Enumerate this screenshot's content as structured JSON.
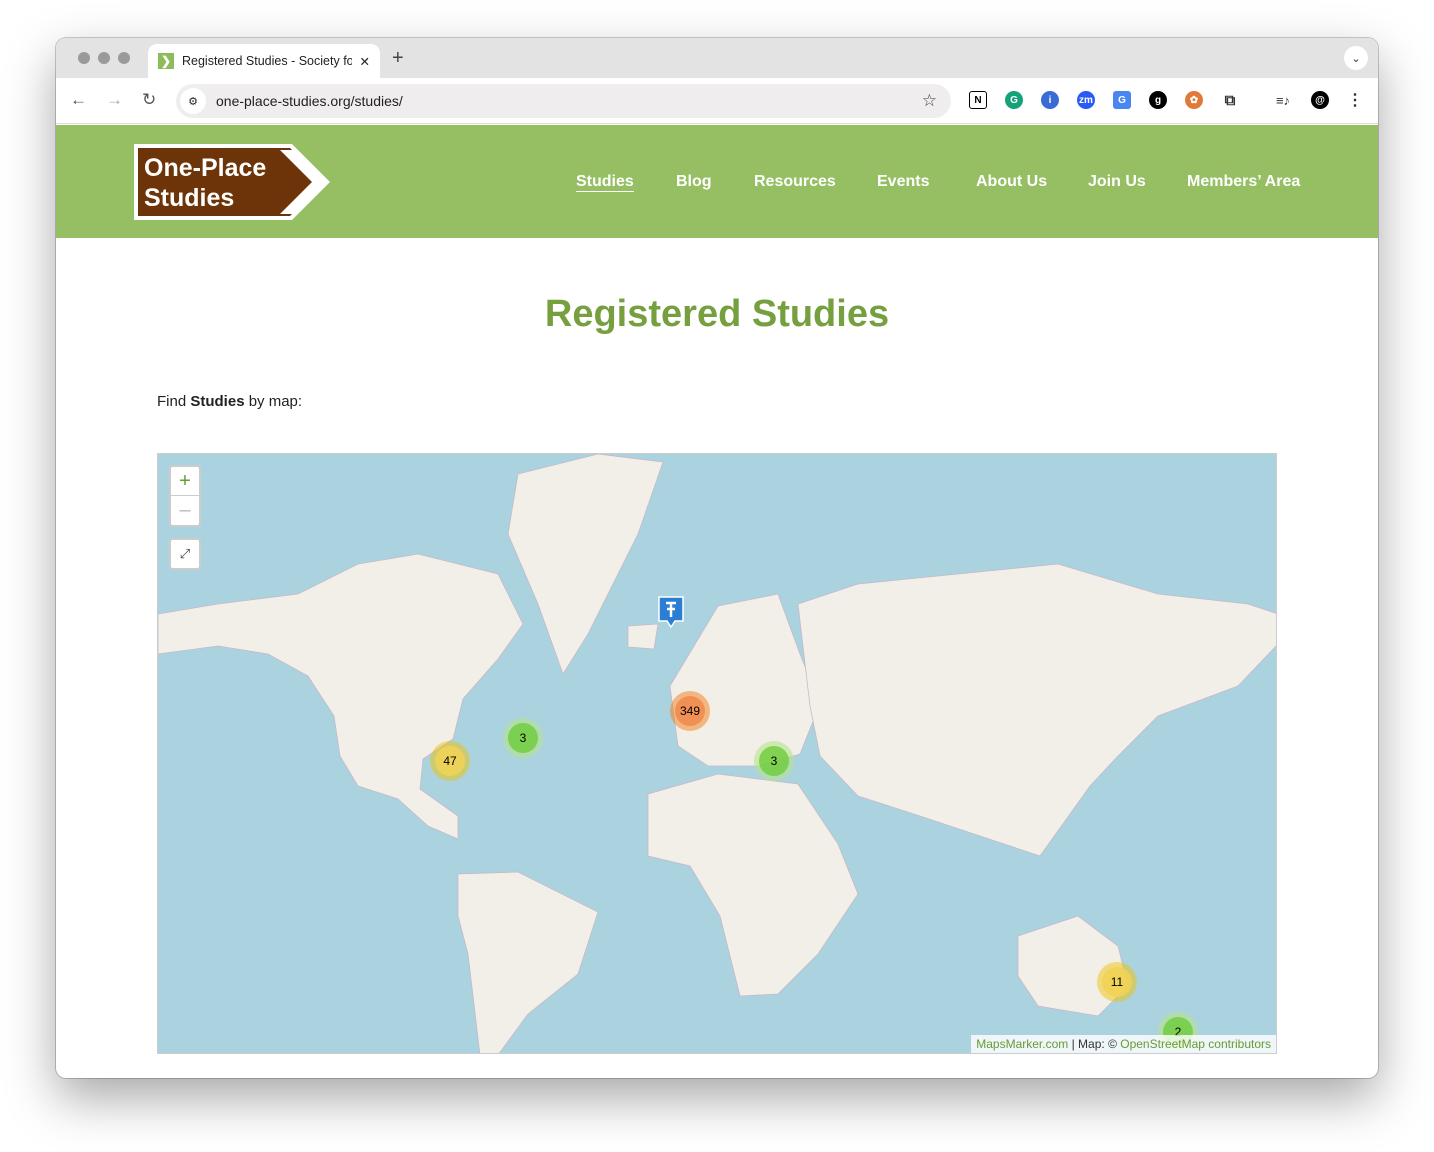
{
  "browser": {
    "tab_title": "Registered Studies - Society for One-Place Studies",
    "url": "one-place-studies.org/studies/"
  },
  "site": {
    "logo_line1": "One-Place",
    "logo_line2": "Studies",
    "menu": [
      "Studies",
      "Blog",
      "Resources",
      "Events",
      "About Us",
      "Join Us",
      "Members’ Area"
    ]
  },
  "page": {
    "title": "Registered Studies",
    "find_prefix": "Find ",
    "find_bold": "Studies",
    "find_suffix": " by map:"
  },
  "map": {
    "zoom_in": "+",
    "zoom_out": "–",
    "clusters": [
      {
        "count": "349",
        "color": "orange"
      },
      {
        "count": "47",
        "color": "yellow"
      },
      {
        "count": "3",
        "color": "green"
      },
      {
        "count": "3",
        "color": "green"
      },
      {
        "count": "11",
        "color": "yellow"
      },
      {
        "count": "2",
        "color": "green"
      }
    ],
    "attribution": {
      "link1": "MapsMarker.com",
      "sep": " | Map: © ",
      "link2": "OpenStreetMap contributors"
    }
  },
  "colors": {
    "header": "#95bf62",
    "title": "#76a040",
    "logo": "#6e3409",
    "ocean": "#aad3df",
    "land": "#f2efe9"
  }
}
